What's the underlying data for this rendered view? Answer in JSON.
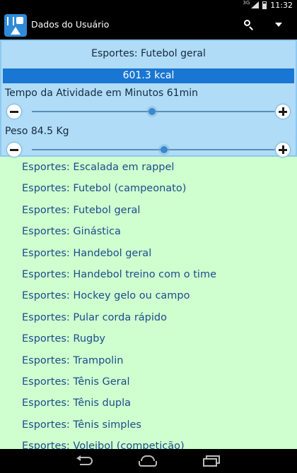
{
  "status_bar": {
    "network": "3G",
    "time": "11:32"
  },
  "action_bar": {
    "title": "Dados do Usuário",
    "icons": [
      "app-icon",
      "search-icon",
      "overflow-menu-icon"
    ]
  },
  "activity": {
    "selected": "Esportes: Futebol geral",
    "calories": "601.3 kcal",
    "time_label": "Tempo da Atividade em Minutos 61min",
    "time_slider_fraction": 0.49,
    "weight_label": "Peso 84.5 Kg",
    "weight_slider_fraction": 0.54
  },
  "list": {
    "items": [
      "Esportes: Escalada em rappel",
      "Esportes: Futebol (campeonato)",
      "Esportes: Futebol geral",
      "Esportes: Ginástica",
      "Esportes: Handebol geral",
      "Esportes: Handebol treino com o time",
      "Esportes: Hockey gelo ou campo",
      "Esportes: Pular corda rápido",
      "Esportes: Rugby",
      "Esportes: Trampolin",
      "Esportes: Tênis Geral",
      "Esportes: Tênis dupla",
      "Esportes: Tênis simples",
      "Esportes: Voleibol (competição)"
    ]
  },
  "nav_bar": {
    "icons": [
      "back-icon",
      "home-icon",
      "recents-icon"
    ]
  },
  "colors": {
    "list_background": "#cfffcf",
    "header_background": "#b0dcf7",
    "accent": "#1976d2",
    "list_text": "#1b4d8a"
  }
}
